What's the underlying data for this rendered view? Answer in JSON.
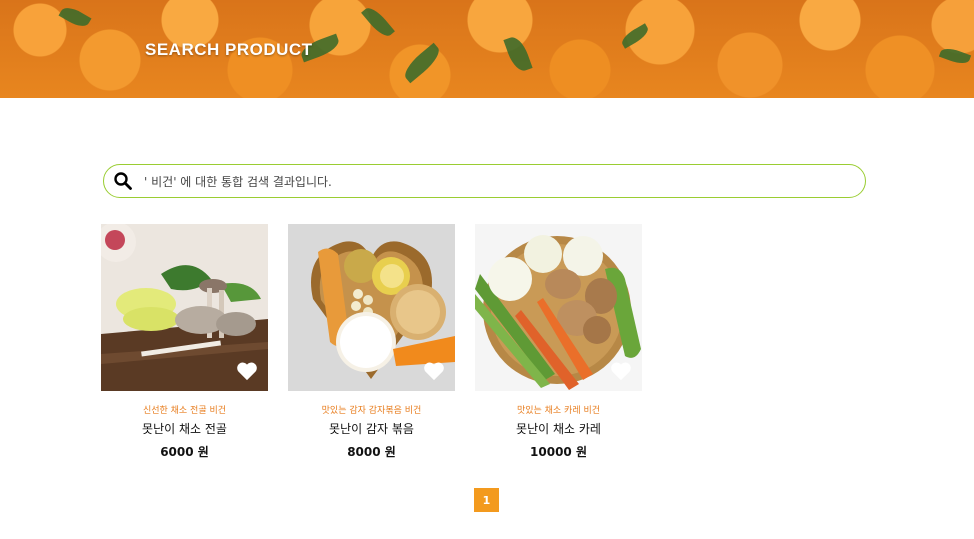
{
  "banner": {
    "title": "SEARCH PRODUCT"
  },
  "search": {
    "text": "' 비건' 에 대한 통합 검색 결과입니다.",
    "icon": "search-icon"
  },
  "products": [
    {
      "subtitle": "신선한 채소 전골 비건",
      "name": "못난이 채소 전골",
      "price": "6000 원"
    },
    {
      "subtitle": "맛있는 감자 감자볶음 비건",
      "name": "못난이 감자 볶음",
      "price": "8000 원"
    },
    {
      "subtitle": "맛있는 채소 카레 비건",
      "name": "못난이 채소 카레",
      "price": "10000 원"
    }
  ],
  "pagination": {
    "current": "1"
  },
  "colors": {
    "accent": "#f39a1e",
    "search_border": "#9acd32",
    "subtitle": "#e87d1e"
  }
}
